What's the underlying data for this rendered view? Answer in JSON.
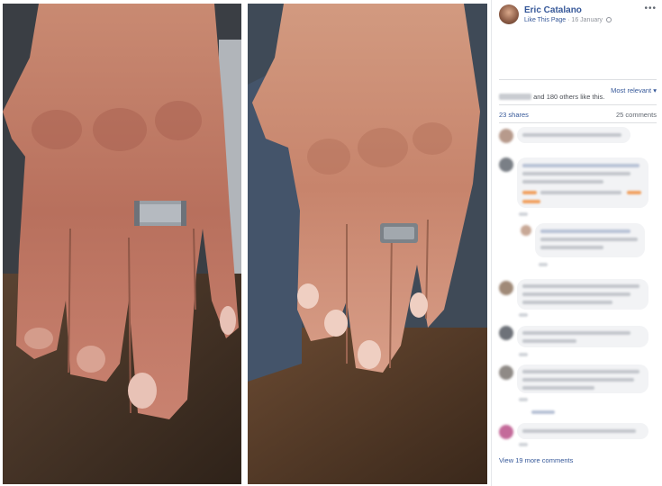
{
  "post": {
    "page_name": "Eric Catalano",
    "like_link": "Like This Page",
    "date": "16 January",
    "more_icon": "more-dots-icon"
  },
  "reactions": {
    "likes_text": "and 180 others like this.",
    "sort_label": "Most relevant",
    "shares_label": "23 shares",
    "comments_label": "25 comments"
  },
  "footer": {
    "view_more": "View 19 more comments"
  },
  "colors": {
    "link": "#365899",
    "meta": "#90949c",
    "bubble": "#f2f3f5"
  }
}
